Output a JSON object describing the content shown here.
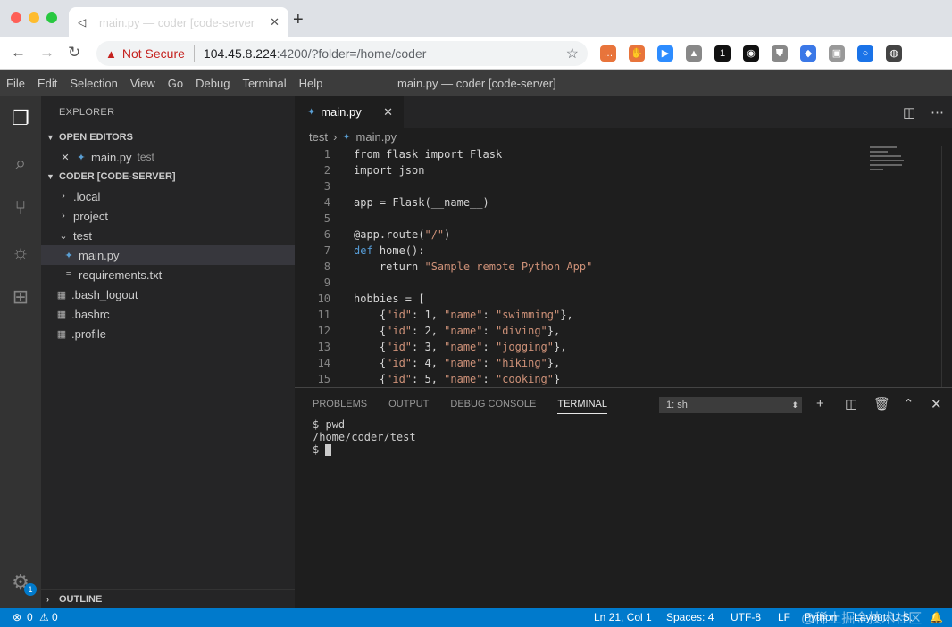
{
  "browser": {
    "tab_title": "main.py — coder [code-server",
    "security": "Not Secure",
    "url_host": "104.45.8.224",
    "url_path": ":4200/?folder=/home/coder",
    "dot_colors": [
      "#fe5f57",
      "#febc2e",
      "#28c840"
    ],
    "extensions": [
      {
        "name": "ext-orange",
        "color": "#e8743b",
        "glyph": "…"
      },
      {
        "name": "ext-orange-hand",
        "color": "#e8743b",
        "glyph": "✋"
      },
      {
        "name": "ext-zoom",
        "color": "#2d8cff",
        "glyph": "▶"
      },
      {
        "name": "ext-drive",
        "color": "#888",
        "glyph": "▲"
      },
      {
        "name": "ext-one",
        "color": "#111",
        "glyph": "1"
      },
      {
        "name": "ext-circle",
        "color": "#111",
        "glyph": "◉"
      },
      {
        "name": "ext-shield",
        "color": "#888",
        "glyph": "⛊"
      },
      {
        "name": "ext-blue",
        "color": "#3b78e7",
        "glyph": "◆"
      },
      {
        "name": "ext-gray",
        "color": "#999",
        "glyph": "▣"
      },
      {
        "name": "ext-ring",
        "color": "#1a73e8",
        "glyph": "○"
      },
      {
        "name": "ext-avatar",
        "color": "#444",
        "glyph": "◍"
      }
    ]
  },
  "menu": {
    "items": [
      "File",
      "Edit",
      "Selection",
      "View",
      "Go",
      "Debug",
      "Terminal",
      "Help"
    ],
    "window_title": "main.py — coder [code-server]"
  },
  "sidebar": {
    "title": "EXPLORER",
    "open_editors": "OPEN EDITORS",
    "open_file": "main.py",
    "open_file_dir": "test",
    "workspace": "CODER [CODE-SERVER]",
    "tree": [
      ".local",
      "project",
      "test",
      "main.py",
      "requirements.txt",
      ".bash_logout",
      ".bashrc",
      ".profile"
    ],
    "outline": "OUTLINE"
  },
  "activity_badge": "1",
  "editor": {
    "tab": "main.py",
    "crumb_dir": "test",
    "crumb_file": "main.py",
    "lines": [
      {
        "n": "1",
        "segs": [
          {
            "c": "t",
            "v": "from "
          },
          {
            "c": "t",
            "v": "flask"
          },
          {
            "c": "t",
            "v": " import "
          },
          {
            "c": "t",
            "v": "Flask"
          }
        ]
      },
      {
        "n": "2",
        "segs": [
          {
            "c": "t",
            "v": "import "
          },
          {
            "c": "t",
            "v": "json"
          }
        ]
      },
      {
        "n": "3",
        "segs": []
      },
      {
        "n": "4",
        "segs": [
          {
            "c": "t",
            "v": "app = Flask(__name__)"
          }
        ]
      },
      {
        "n": "5",
        "segs": []
      },
      {
        "n": "6",
        "segs": [
          {
            "c": "t",
            "v": "@app.route("
          },
          {
            "c": "s",
            "v": "\"/\""
          },
          {
            "c": "t",
            "v": ")"
          }
        ]
      },
      {
        "n": "7",
        "segs": [
          {
            "c": "k",
            "v": "def"
          },
          {
            "c": "t",
            "v": " home():"
          }
        ]
      },
      {
        "n": "8",
        "segs": [
          {
            "c": "t",
            "v": "    return "
          },
          {
            "c": "s",
            "v": "\"Sample remote Python App\""
          }
        ]
      },
      {
        "n": "9",
        "segs": []
      },
      {
        "n": "10",
        "segs": [
          {
            "c": "t",
            "v": "hobbies = ["
          }
        ]
      },
      {
        "n": "11",
        "segs": [
          {
            "c": "t",
            "v": "    {"
          },
          {
            "c": "s",
            "v": "\"id\""
          },
          {
            "c": "t",
            "v": ": 1, "
          },
          {
            "c": "s",
            "v": "\"name\""
          },
          {
            "c": "t",
            "v": ": "
          },
          {
            "c": "s",
            "v": "\"swimming\""
          },
          {
            "c": "t",
            "v": "},"
          }
        ]
      },
      {
        "n": "12",
        "segs": [
          {
            "c": "t",
            "v": "    {"
          },
          {
            "c": "s",
            "v": "\"id\""
          },
          {
            "c": "t",
            "v": ": 2, "
          },
          {
            "c": "s",
            "v": "\"name\""
          },
          {
            "c": "t",
            "v": ": "
          },
          {
            "c": "s",
            "v": "\"diving\""
          },
          {
            "c": "t",
            "v": "},"
          }
        ]
      },
      {
        "n": "13",
        "segs": [
          {
            "c": "t",
            "v": "    {"
          },
          {
            "c": "s",
            "v": "\"id\""
          },
          {
            "c": "t",
            "v": ": 3, "
          },
          {
            "c": "s",
            "v": "\"name\""
          },
          {
            "c": "t",
            "v": ": "
          },
          {
            "c": "s",
            "v": "\"jogging\""
          },
          {
            "c": "t",
            "v": "},"
          }
        ]
      },
      {
        "n": "14",
        "segs": [
          {
            "c": "t",
            "v": "    {"
          },
          {
            "c": "s",
            "v": "\"id\""
          },
          {
            "c": "t",
            "v": ": 4, "
          },
          {
            "c": "s",
            "v": "\"name\""
          },
          {
            "c": "t",
            "v": ": "
          },
          {
            "c": "s",
            "v": "\"hiking\""
          },
          {
            "c": "t",
            "v": "},"
          }
        ]
      },
      {
        "n": "15",
        "segs": [
          {
            "c": "t",
            "v": "    {"
          },
          {
            "c": "s",
            "v": "\"id\""
          },
          {
            "c": "t",
            "v": ": 5, "
          },
          {
            "c": "s",
            "v": "\"name\""
          },
          {
            "c": "t",
            "v": ": "
          },
          {
            "c": "s",
            "v": "\"cooking\""
          },
          {
            "c": "t",
            "v": "}"
          }
        ]
      }
    ]
  },
  "panel": {
    "tabs": [
      "PROBLEMS",
      "OUTPUT",
      "DEBUG CONSOLE",
      "TERMINAL"
    ],
    "terminal_select": "1: sh",
    "terminal_lines": [
      "$ pwd",
      "/home/coder/test",
      "$ "
    ]
  },
  "status": {
    "errors": "0",
    "warnings": "0",
    "position": "Ln 21, Col 1",
    "spaces": "Spaces: 4",
    "encoding": "UTF-8",
    "eol": "LF",
    "language": "Python",
    "layout": "Layout: U.S.",
    "watermark": "@稀土掘金技术社区"
  }
}
